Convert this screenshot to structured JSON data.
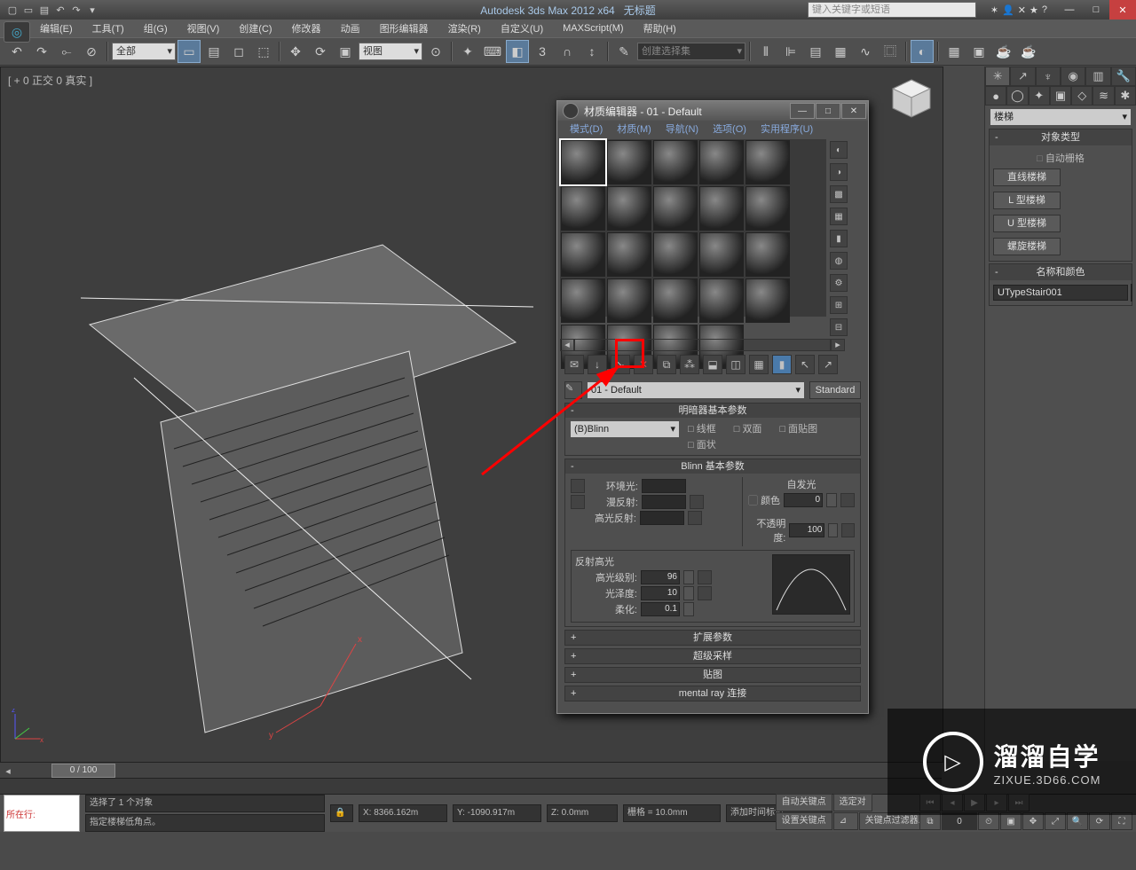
{
  "app": {
    "title": "Autodesk 3ds Max 2012 x64",
    "doc": "无标题",
    "search_placeholder": "键入关键字或短语"
  },
  "menubar": [
    "编辑(E)",
    "工具(T)",
    "组(G)",
    "视图(V)",
    "创建(C)",
    "修改器",
    "动画",
    "图形编辑器",
    "渲染(R)",
    "自定义(U)",
    "MAXScript(M)",
    "帮助(H)"
  ],
  "toolbar": {
    "selset": "全部",
    "view": "视图",
    "named_sel_place": "创建选择集"
  },
  "viewport": {
    "label": "[ + 0  正交 0 真实 ]"
  },
  "cmdpanel": {
    "category": "楼梯",
    "objtype_title": "对象类型",
    "autogrid": "自动栅格",
    "buttons": [
      "直线楼梯",
      "L 型楼梯",
      "U 型楼梯",
      "螺旋楼梯"
    ],
    "namecolor_title": "名称和颜色",
    "obj_name": "UTypeStair001"
  },
  "matdlg": {
    "title": "材质编辑器 - 01 - Default",
    "menu": [
      "模式(D)",
      "材质(M)",
      "导航(N)",
      "选项(O)",
      "实用程序(U)"
    ],
    "mat_name": "01 - Default",
    "type_btn": "Standard",
    "shader_roll": "明暗器基本参数",
    "shader": "(B)Blinn",
    "chk": [
      "线框",
      "双面",
      "面贴图",
      "面状"
    ],
    "blinn_roll": "Blinn 基本参数",
    "selfillum": "自发光",
    "color": "颜色",
    "color_v": "0",
    "ambient": "环境光:",
    "diffuse": "漫反射:",
    "specular": "高光反射:",
    "opacity": "不透明度:",
    "opacity_v": "100",
    "spec_title": "反射高光",
    "spec_level": "高光级别:",
    "spec_level_v": "96",
    "gloss": "光泽度:",
    "gloss_v": "10",
    "soften": "柔化:",
    "soften_v": "0.1",
    "rolls": [
      "扩展参数",
      "超级采样",
      "贴图",
      "mental ray 连接"
    ]
  },
  "time": {
    "slider": "0 / 100"
  },
  "status": {
    "sel": "选择了 1 个对象",
    "x": "X: 8366.162m",
    "y": "Y: -1090.917m",
    "z": "Z: 0.0mm",
    "grid": "栅格 = 10.0mm",
    "addtime": "添加时间标记",
    "autokey": "自动关键点",
    "selset2": "选定对",
    "setkey": "设置关键点",
    "filter": "关键点过滤器...",
    "listener_prompt": "所在行:",
    "prompt": "指定楼梯低角点。"
  },
  "watermark": {
    "big": "溜溜自学",
    "small": "ZIXUE.3D66.COM",
    "play": "▷"
  }
}
